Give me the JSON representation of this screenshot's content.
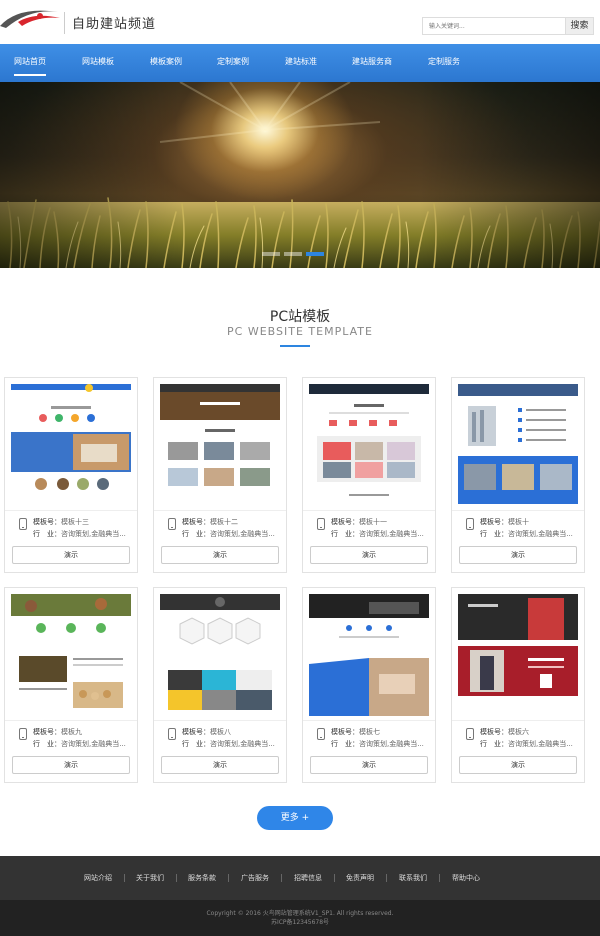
{
  "header": {
    "site_title": "自助建站频道",
    "search_placeholder": "输入关键词...",
    "search_button": "搜索"
  },
  "nav": {
    "items": [
      "网站首页",
      "网站模板",
      "模板案例",
      "定制案例",
      "建站标准",
      "建站服务商",
      "定制服务"
    ],
    "active_index": 0
  },
  "banner": {
    "slides": 3,
    "active_slide": 3
  },
  "section": {
    "title": "PC站模板",
    "subtitle": "PC WEBSITE TEMPLATE"
  },
  "card_labels": {
    "model_label": "模板号：",
    "industry_label": "行　业：",
    "demo_button": "演示"
  },
  "templates": [
    {
      "model": "模板十三",
      "industry": "咨询策划,金融典当..."
    },
    {
      "model": "模板十二",
      "industry": "咨询策划,金融典当..."
    },
    {
      "model": "模板十一",
      "industry": "咨询策划,金融典当..."
    },
    {
      "model": "模板十",
      "industry": "咨询策划,金融典当..."
    },
    {
      "model": "模板九",
      "industry": "咨询策划,金融典当..."
    },
    {
      "model": "模板八",
      "industry": "咨询策划,金融典当..."
    },
    {
      "model": "模板七",
      "industry": "咨询策划,金融典当..."
    },
    {
      "model": "模板六",
      "industry": "咨询策划,金融典当..."
    }
  ],
  "more_button": "更多 +",
  "footer": {
    "links": [
      "网站介绍",
      "关于我们",
      "服务条款",
      "广告服务",
      "招聘信息",
      "免责声明",
      "联系我们",
      "帮助中心"
    ],
    "copyright": "Copyright © 2016 火鸟网站管理系统V1_SP1. All rights reserved.",
    "icp": "苏ICP备12345678号"
  },
  "colors": {
    "accent": "#2d85e0",
    "nav_bg": "#3a88e0",
    "footer_bg": "#333333",
    "copyright_bg": "#222222"
  }
}
